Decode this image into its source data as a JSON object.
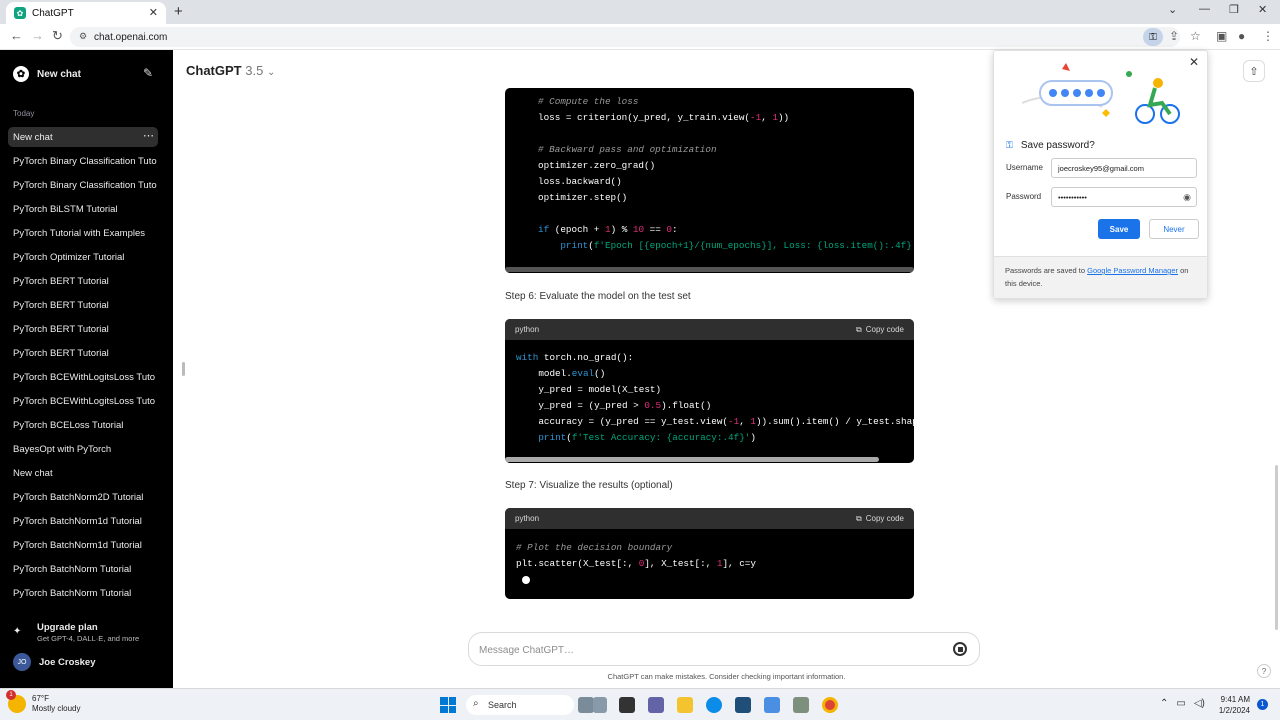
{
  "browser": {
    "tab_title": "ChatGPT",
    "new_tab_icon": "plus-icon",
    "url": "chat.openai.com"
  },
  "sidebar": {
    "new_chat_label": "New chat",
    "section_label": "Today",
    "items": [
      {
        "label": "New chat"
      },
      {
        "label": "PyTorch Binary Classification Tuto"
      },
      {
        "label": "PyTorch Binary Classification Tuto"
      },
      {
        "label": "PyTorch BiLSTM Tutorial"
      },
      {
        "label": "PyTorch Tutorial with Examples"
      },
      {
        "label": "PyTorch Optimizer Tutorial"
      },
      {
        "label": "PyTorch BERT Tutorial"
      },
      {
        "label": "PyTorch BERT Tutorial"
      },
      {
        "label": "PyTorch BERT Tutorial"
      },
      {
        "label": "PyTorch BERT Tutorial"
      },
      {
        "label": "PyTorch BCEWithLogitsLoss Tuto"
      },
      {
        "label": "PyTorch BCEWithLogitsLoss Tuto"
      },
      {
        "label": "PyTorch BCELoss Tutorial"
      },
      {
        "label": "BayesOpt with PyTorch"
      },
      {
        "label": "New chat"
      },
      {
        "label": "PyTorch BatchNorm2D Tutorial"
      },
      {
        "label": "PyTorch BatchNorm1d Tutorial"
      },
      {
        "label": "PyTorch BatchNorm1d Tutorial"
      },
      {
        "label": "PyTorch BatchNorm Tutorial"
      },
      {
        "label": "PyTorch BatchNorm Tutorial"
      }
    ],
    "upgrade_title": "Upgrade plan",
    "upgrade_subtitle": "Get GPT-4, DALL·E, and more",
    "user_initials": "JO",
    "user_name": "Joe Croskey"
  },
  "main": {
    "model_name": "ChatGPT",
    "model_version": "3.5",
    "step6": "Step 6: Evaluate the model on the test set",
    "step7": "Step 7: Visualize the results (optional)",
    "code_lang": "python",
    "copy_label": "Copy code",
    "composer_placeholder": "Message ChatGPT…",
    "disclaimer": "ChatGPT can make mistakes. Consider checking important information."
  },
  "password_popup": {
    "title": "Save password?",
    "username_label": "Username",
    "username_value": "joecroskey95@gmail.com",
    "password_label": "Password",
    "password_value": "•••••••••••",
    "save_label": "Save",
    "never_label": "Never",
    "footer_pre": "Passwords are saved to ",
    "footer_link": "Google Password Manager",
    "footer_post": " on this device."
  },
  "taskbar": {
    "temperature": "67°F",
    "weather_desc": "Mostly cloudy",
    "weather_badge": "1",
    "search_label": "Search",
    "time": "9:41 AM",
    "date": "1/2/2024",
    "notif_count": "1"
  }
}
